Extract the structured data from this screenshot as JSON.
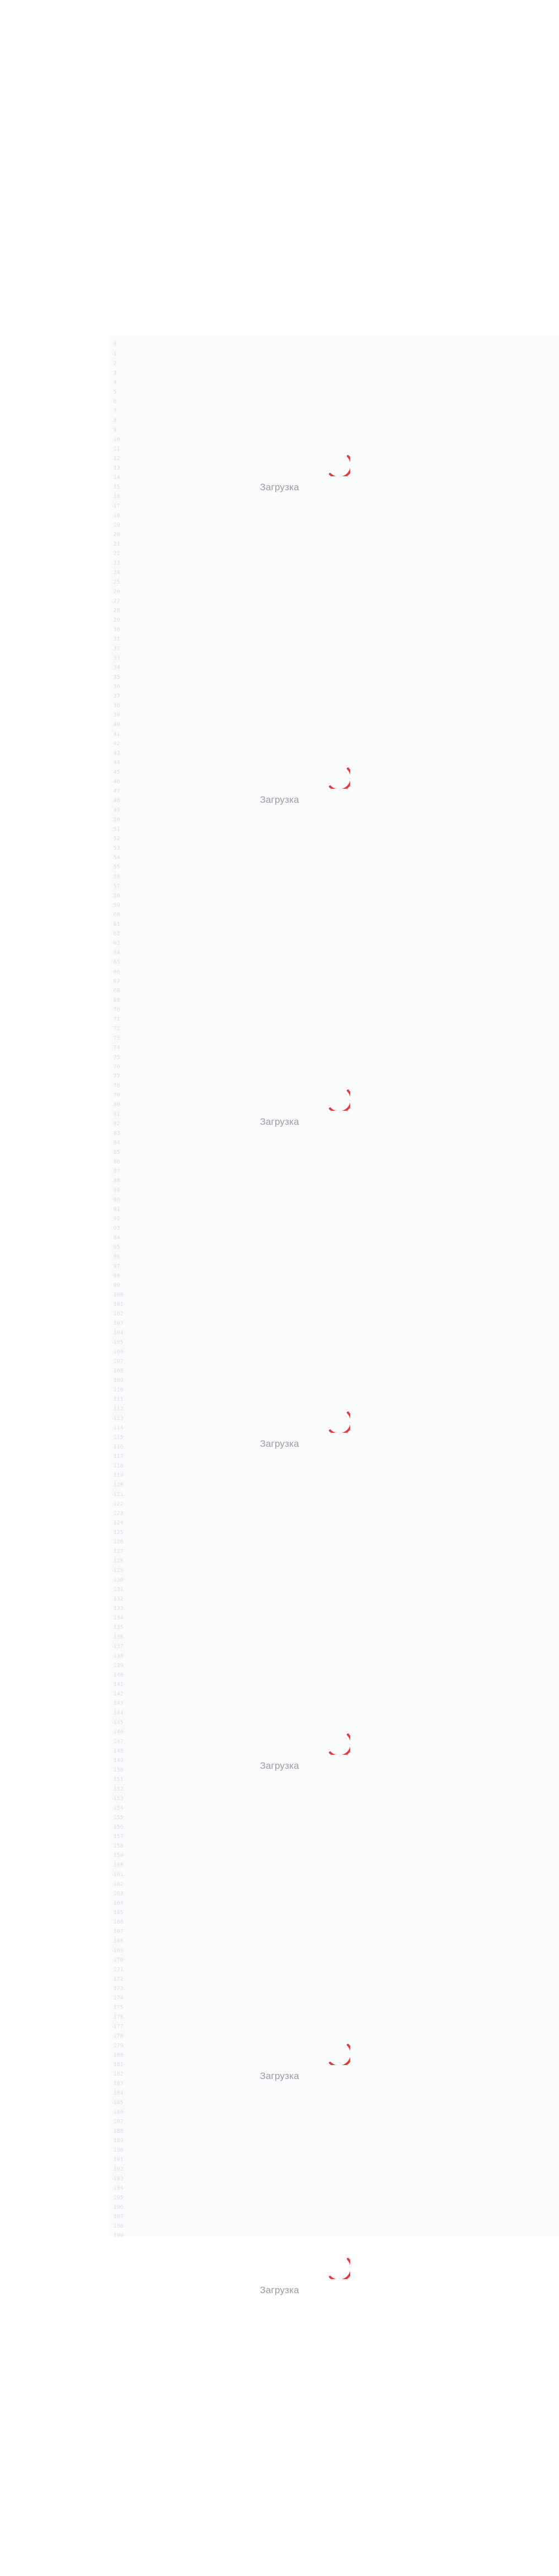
{
  "loader_label": "Загрузка",
  "accent_color": "#e53935",
  "line_numbers": [
    "0",
    "1",
    "2",
    "3",
    "4",
    "5",
    "6",
    "7",
    "8",
    "9",
    "10",
    "11",
    "12",
    "13",
    "14",
    "15",
    "16",
    "17",
    "18",
    "19",
    "20",
    "21",
    "22",
    "23",
    "24",
    "25",
    "26",
    "27",
    "28",
    "29",
    "30",
    "31",
    "32",
    "33",
    "34",
    "35",
    "36",
    "37",
    "38",
    "39",
    "40",
    "41",
    "42",
    "43",
    "44",
    "45",
    "46",
    "47",
    "48",
    "49",
    "50",
    "51",
    "52",
    "53",
    "54",
    "55",
    "56",
    "57",
    "58",
    "59",
    "60",
    "61",
    "62",
    "63",
    "64",
    "65",
    "66",
    "67",
    "68",
    "69",
    "70",
    "71",
    "72",
    "73",
    "74",
    "75",
    "76",
    "77",
    "78",
    "79",
    "80",
    "81",
    "82",
    "83",
    "84",
    "85",
    "86",
    "87",
    "88",
    "89",
    "90",
    "91",
    "92",
    "93",
    "94",
    "95",
    "96",
    "97",
    "98",
    "99",
    "100",
    "101",
    "102",
    "103",
    "104",
    "105",
    "106",
    "107",
    "108",
    "109",
    "110",
    "111",
    "112",
    "113",
    "114",
    "115",
    "116",
    "117",
    "118",
    "119",
    "120",
    "121",
    "122",
    "123",
    "124",
    "125",
    "126",
    "127",
    "128",
    "129",
    "130",
    "131",
    "132",
    "133",
    "134",
    "135",
    "136",
    "137",
    "138",
    "139",
    "140",
    "141",
    "142",
    "143",
    "144",
    "145",
    "146",
    "147",
    "148",
    "149",
    "150",
    "151",
    "152",
    "153",
    "154",
    "155",
    "156",
    "157",
    "158",
    "159",
    "160",
    "161",
    "162",
    "163",
    "164",
    "165",
    "166",
    "167",
    "168",
    "169",
    "170",
    "171",
    "172",
    "173",
    "174",
    "175",
    "176",
    "177",
    "178",
    "179",
    "180",
    "181",
    "182",
    "183",
    "184",
    "185",
    "186",
    "187",
    "188",
    "189",
    "190",
    "191",
    "192",
    "193",
    "194",
    "195",
    "196",
    "197",
    "198",
    "199"
  ],
  "loaders": [
    {
      "label": "Загрузка"
    },
    {
      "label": "Загрузка"
    },
    {
      "label": "Загрузка"
    },
    {
      "label": "Загрузка"
    },
    {
      "label": "Загрузка"
    },
    {
      "label": "Загрузка"
    },
    {
      "label": "Загрузка"
    }
  ]
}
